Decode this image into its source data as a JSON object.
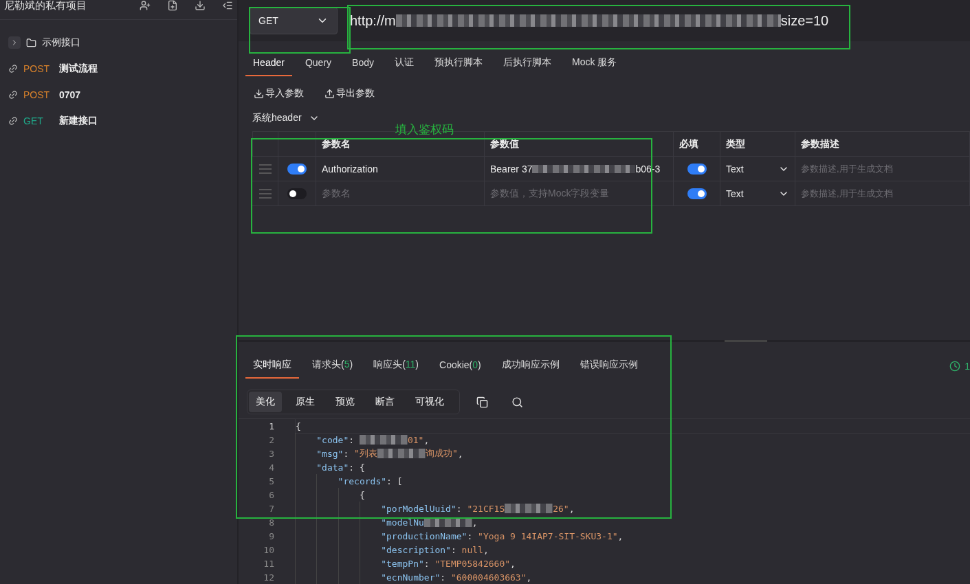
{
  "sidebar": {
    "title": "尼勒斌的私有项目",
    "items": [
      {
        "kind": "folder",
        "label": "示例接口",
        "expanded": false
      },
      {
        "kind": "api",
        "method": "POST",
        "color": "#d9822b",
        "label": "测试流程"
      },
      {
        "kind": "api",
        "method": "POST",
        "color": "#d9822b",
        "label": "0707"
      },
      {
        "kind": "api",
        "method": "GET",
        "color": "#1fa98a",
        "label": "新建接口"
      }
    ]
  },
  "request": {
    "method": "GET",
    "url_start": "http://m",
    "url_end": "size=10"
  },
  "tabs": [
    {
      "label": "Header",
      "selected": true
    },
    {
      "label": "Query",
      "selected": false
    },
    {
      "label": "Body",
      "selected": false
    },
    {
      "label": "认证",
      "selected": false
    },
    {
      "label": "预执行脚本",
      "selected": false
    },
    {
      "label": "后执行脚本",
      "selected": false
    },
    {
      "label": "Mock 服务",
      "selected": false
    }
  ],
  "actions": [
    {
      "kind": "import",
      "label": "导入参数"
    },
    {
      "kind": "export",
      "label": "导出参数"
    }
  ],
  "system_header": "系统header",
  "table": {
    "columns": [
      "参数名",
      "参数值",
      "必填",
      "类型",
      "参数描述"
    ],
    "rows": [
      {
        "enabled": true,
        "name": "Authorization",
        "value_start": "Bearer 37",
        "value_end": "b06-3",
        "required": true,
        "type": "Text",
        "description_placeholder": "参数描述,用于生成文档"
      },
      {
        "enabled": false,
        "name_placeholder": "参数名",
        "value_placeholder": "参数值，支持Mock字段变量",
        "required": true,
        "type": "Text",
        "description_placeholder": "参数描述,用于生成文档"
      }
    ]
  },
  "response": {
    "tabs": [
      {
        "label": "实时响应",
        "selected": true
      },
      {
        "label": "请求头(",
        "count": "5",
        "suffix": ")",
        "selected": false
      },
      {
        "label": "响应头(",
        "count": "11",
        "suffix": ")",
        "selected": false
      },
      {
        "label": "Cookie(",
        "count": "0",
        "suffix": ")",
        "selected": false
      },
      {
        "label": "成功响应示例",
        "selected": false
      },
      {
        "label": "错误响应示例",
        "selected": false
      }
    ],
    "timer": "1",
    "views": [
      {
        "label": "美化",
        "selected": true
      },
      {
        "label": "原生",
        "selected": false
      },
      {
        "label": "预览",
        "selected": false
      },
      {
        "label": "断言",
        "selected": false
      },
      {
        "label": "可视化",
        "selected": false
      }
    ],
    "lines": [
      {
        "number": "1",
        "current": true,
        "tokens": [
          {
            "kind": "punct",
            "text": "{"
          }
        ]
      },
      {
        "number": "2",
        "current": false,
        "tokens": [
          {
            "kind": "key",
            "text": "    \"code\""
          },
          {
            "kind": "punct",
            "text": ": "
          },
          {
            "kind": "redacted"
          },
          {
            "kind": "string",
            "text": "01\""
          },
          {
            "kind": "punct",
            "text": ","
          }
        ]
      },
      {
        "number": "3",
        "current": false,
        "tokens": [
          {
            "kind": "key",
            "text": "    \"msg\""
          },
          {
            "kind": "punct",
            "text": ": "
          },
          {
            "kind": "string",
            "text": "\"列表"
          },
          {
            "kind": "redacted"
          },
          {
            "kind": "string",
            "text": "询成功\""
          },
          {
            "kind": "punct",
            "text": ","
          }
        ]
      },
      {
        "number": "4",
        "current": false,
        "tokens": [
          {
            "kind": "key",
            "text": "    \"data\""
          },
          {
            "kind": "punct",
            "text": ": {"
          }
        ]
      },
      {
        "number": "5",
        "current": false,
        "tokens": [
          {
            "kind": "key",
            "text": "        \"records\""
          },
          {
            "kind": "punct",
            "text": ": ["
          }
        ]
      },
      {
        "number": "6",
        "current": false,
        "tokens": [
          {
            "kind": "punct",
            "text": "            {"
          }
        ]
      },
      {
        "number": "7",
        "current": false,
        "tokens": [
          {
            "kind": "key",
            "text": "                \"porModelUuid\""
          },
          {
            "kind": "punct",
            "text": ": "
          },
          {
            "kind": "string",
            "text": "\"21CF1S"
          },
          {
            "kind": "redacted"
          },
          {
            "kind": "string",
            "text": "26\""
          },
          {
            "kind": "punct",
            "text": ","
          }
        ]
      },
      {
        "number": "8",
        "current": false,
        "tokens": [
          {
            "kind": "key",
            "text": "                \"modelNu"
          },
          {
            "kind": "redacted"
          },
          {
            "kind": "punct",
            "text": ","
          }
        ]
      },
      {
        "number": "9",
        "current": false,
        "tokens": [
          {
            "kind": "key",
            "text": "                \"productionName\""
          },
          {
            "kind": "punct",
            "text": ": "
          },
          {
            "kind": "string",
            "text": "\"Yoga 9 14IAP7-SIT-SKU3-1\""
          },
          {
            "kind": "punct",
            "text": ","
          }
        ]
      },
      {
        "number": "10",
        "current": false,
        "tokens": [
          {
            "kind": "key",
            "text": "                \"description\""
          },
          {
            "kind": "punct",
            "text": ": "
          },
          {
            "kind": "null",
            "text": "null"
          },
          {
            "kind": "punct",
            "text": ","
          }
        ]
      },
      {
        "number": "11",
        "current": false,
        "tokens": [
          {
            "kind": "key",
            "text": "                \"tempPn\""
          },
          {
            "kind": "punct",
            "text": ": "
          },
          {
            "kind": "string",
            "text": "\"TEMP05842660\""
          },
          {
            "kind": "punct",
            "text": ","
          }
        ]
      },
      {
        "number": "12",
        "current": false,
        "tokens": [
          {
            "kind": "key",
            "text": "                \"ecnNumber\""
          },
          {
            "kind": "punct",
            "text": ": "
          },
          {
            "kind": "string",
            "text": "\"600004603663\""
          },
          {
            "kind": "punct",
            "text": ","
          }
        ]
      }
    ]
  },
  "annotations": {
    "note": "填入鉴权码"
  }
}
